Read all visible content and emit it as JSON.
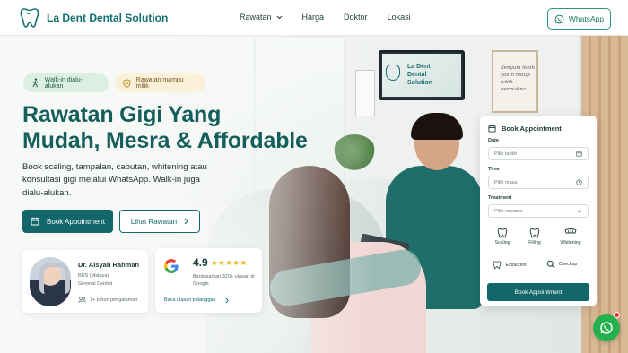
{
  "nav": {
    "brand": "La Dent Dental Solution",
    "items": [
      "Rawatan",
      "Harga",
      "Doktor",
      "Lokasi"
    ],
    "whatsapp": "WhatsApp"
  },
  "badges": [
    "Walk-in dialu-alukan",
    "Rawatan mampu milik"
  ],
  "hero": {
    "title_line1": "Rawatan Gigi Yang",
    "title_line2": "Mudah, Mesra & Affordable",
    "description": "Book scaling, tampalan, cabutan, whitening atau konsultasi gigi melalui WhatsApp. Walk-in juga dialu-alukan.",
    "primary_cta": "Book Appointment",
    "secondary_cta": "Lihat Rawatan"
  },
  "doctor": {
    "name": "Dr. Aisyah Rahman",
    "qual": "BDS (Malaya)",
    "role": "General Dentist",
    "experience": "7+ tahun pengalaman"
  },
  "rating": {
    "score": "4.9",
    "stars": "★★★★★",
    "subtitle": "Berdasarkan 320+ ulasan di Google",
    "link": "Baca ulasan pelanggan"
  },
  "booking": {
    "title": "Book Appointment",
    "date_label": "Date",
    "date_placeholder": "Pilih tarikh",
    "time_label": "Time",
    "time_placeholder": "Pilih masa",
    "treatment_label": "Treatment",
    "treatment_placeholder": "Pilih rawatan",
    "services": [
      "Scaling",
      "Filling",
      "Whitening",
      "Extraction",
      "Checkup"
    ],
    "submit": "Book Appointment"
  },
  "scene": {
    "tv_text": "La Dent Dental Solution",
    "frame_text": "Senyum lebih yakin hidup lebih bermakna"
  },
  "colors": {
    "primary": "#13676a",
    "whatsapp": "#23b14d",
    "star": "#f2b01e"
  }
}
